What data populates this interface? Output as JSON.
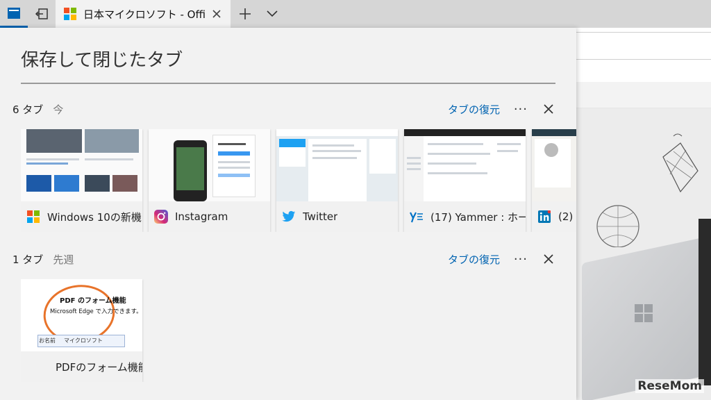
{
  "browser": {
    "active_tab": {
      "title": "日本マイクロソフト - Offici"
    }
  },
  "panel": {
    "title": "保存して閉じたタブ",
    "groups": [
      {
        "count_label": "6 タブ",
        "time_label": "今",
        "restore_label": "タブの復元",
        "more_label": "···",
        "tabs": [
          {
            "label": "Windows 10の新機",
            "icon": "windows-logo-icon"
          },
          {
            "label": "Instagram",
            "icon": "instagram-icon"
          },
          {
            "label": "Twitter",
            "icon": "twitter-bird-icon"
          },
          {
            "label": "(17) Yammer : ホー",
            "icon": "yammer-icon"
          },
          {
            "label": "(2)",
            "icon": "linkedin-icon"
          }
        ]
      },
      {
        "count_label": "1 タブ",
        "time_label": "先週",
        "restore_label": "タブの復元",
        "more_label": "···",
        "tabs": [
          {
            "label": "PDFのフォーム機能",
            "icon": "none"
          }
        ],
        "preview_text": {
          "heading": "PDF のフォーム機能",
          "subheading": "Microsoft Edge で入力できます。",
          "field_label": "お名前",
          "field_value": "マイクロソフト"
        }
      }
    ]
  },
  "background_page": {
    "brand": "ReseMom"
  },
  "colors": {
    "accent": "#0063b1",
    "twitter": "#1da1f2",
    "linkedin": "#0077b5",
    "yammer": "#0072c6"
  }
}
